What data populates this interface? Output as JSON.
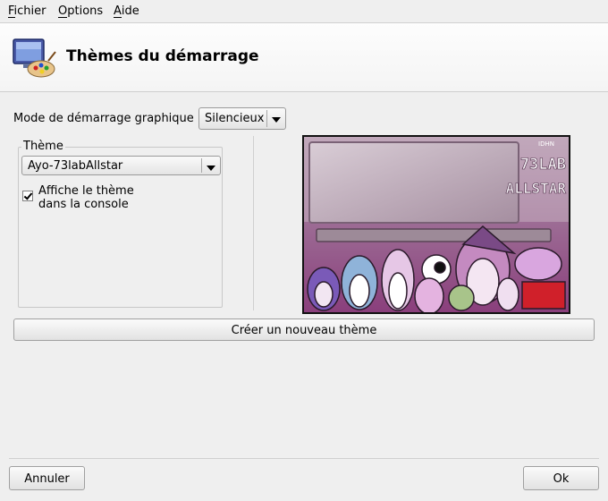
{
  "menu": {
    "items": [
      {
        "label": "Fichier"
      },
      {
        "label": "Options"
      },
      {
        "label": "Aide"
      }
    ]
  },
  "header": {
    "title": "Thèmes du démarrage",
    "icon": "monitor-palette-icon"
  },
  "boot_mode": {
    "label": "Mode de démarrage graphique :",
    "selected": "Silencieux"
  },
  "theme_group": {
    "title": "Thème",
    "selected_theme": "Ayo-73labAllstar",
    "checkbox_label_line1": "Affiche le thème",
    "checkbox_label_line2": "dans la console",
    "checkbox_checked": true
  },
  "preview": {
    "brand_small": "IDHN",
    "brand_line1": "73LAB",
    "brand_line2": "ALLSTAR"
  },
  "buttons": {
    "create_theme": "Créer un nouveau thème",
    "cancel": "Annuler",
    "ok": "Ok"
  },
  "colors": {
    "background": "#efefef",
    "preview_purple": "#9a4a86"
  }
}
